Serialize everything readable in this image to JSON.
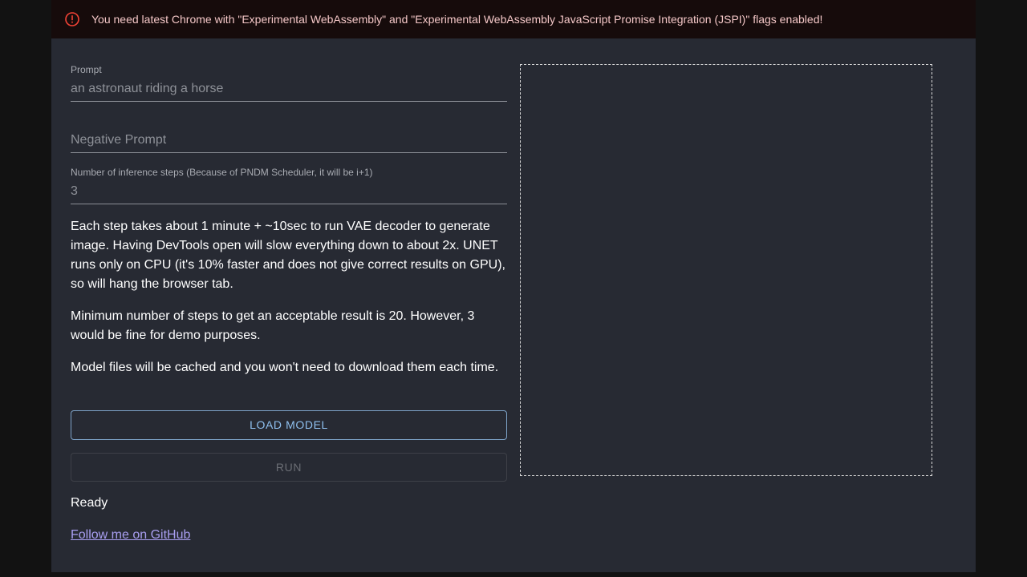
{
  "alert": {
    "icon": "error-outline-icon",
    "color": "#f44336",
    "message": "You need latest Chrome with \"Experimental WebAssembly\" and \"Experimental WebAssembly JavaScript Promise Integration (JSPI)\" flags enabled!"
  },
  "form": {
    "prompt": {
      "label": "Prompt",
      "value": "an astronaut riding a horse"
    },
    "negative_prompt": {
      "placeholder": "Negative Prompt",
      "value": ""
    },
    "steps": {
      "label": "Number of inference steps (Because of PNDM Scheduler, it will be i+1)",
      "value": "3"
    }
  },
  "info": {
    "paragraph_1": "Each step takes about 1 minute + ~10sec to run VAE decoder to generate image. Having DevTools open will slow everything down to about 2x. UNET runs only on CPU (it's 10% faster and does not give correct results on GPU), so will hang the browser tab.",
    "paragraph_2": "Minimum number of steps to get an acceptable result is 20. However, 3 would be fine for demo purposes.",
    "paragraph_3": "Model files will be cached and you won't need to download them each time."
  },
  "actions": {
    "load_label": "LOAD MODEL",
    "run_label": "RUN"
  },
  "status": "Ready",
  "footer": {
    "github_link": "Follow me on GitHub"
  },
  "colors": {
    "page_background": "#121212",
    "panel_background": "#272a33",
    "alert_background": "#160b0b",
    "alert_text": "#f4c7c7",
    "primary_button": "#8fc0ef",
    "link": "#a89ef0"
  }
}
